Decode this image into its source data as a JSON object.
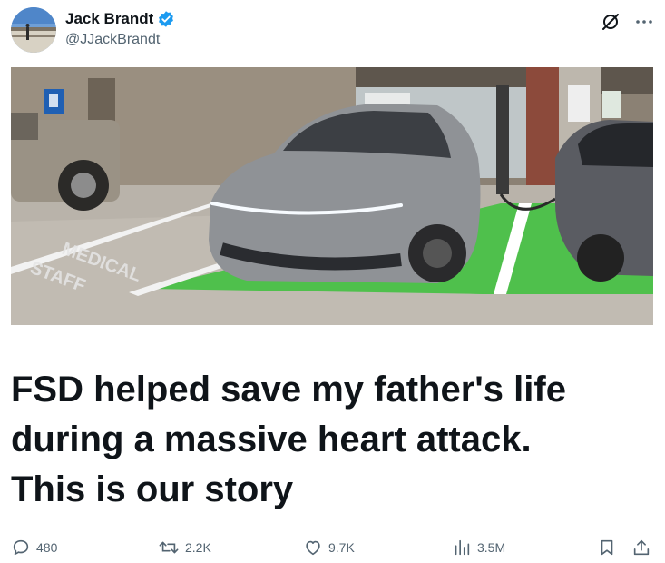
{
  "author": {
    "display_name": "Jack Brandt",
    "handle": "@JJackBrandt",
    "verified": true,
    "avatar_icon": "profile-photo"
  },
  "top_icons": [
    "grok-icon",
    "more-icon"
  ],
  "media": {
    "floor_markings": [
      "MEDICAL",
      "STAFF"
    ],
    "colors": {
      "charging_bay_green": "#4fc04c",
      "car_silver": "#8f9296",
      "wall": "#8b8174",
      "floor": "#b9b3aa"
    }
  },
  "headline_lines": [
    "FSD helped save my father's life",
    "during a massive heart attack.",
    "This is our story"
  ],
  "actions": {
    "replies": "480",
    "reposts": "2.2K",
    "likes": "9.7K",
    "views": "3.5M"
  },
  "colors": {
    "text_primary": "#0f1419",
    "text_secondary": "#536471",
    "verified_blue": "#1d9bf0"
  }
}
